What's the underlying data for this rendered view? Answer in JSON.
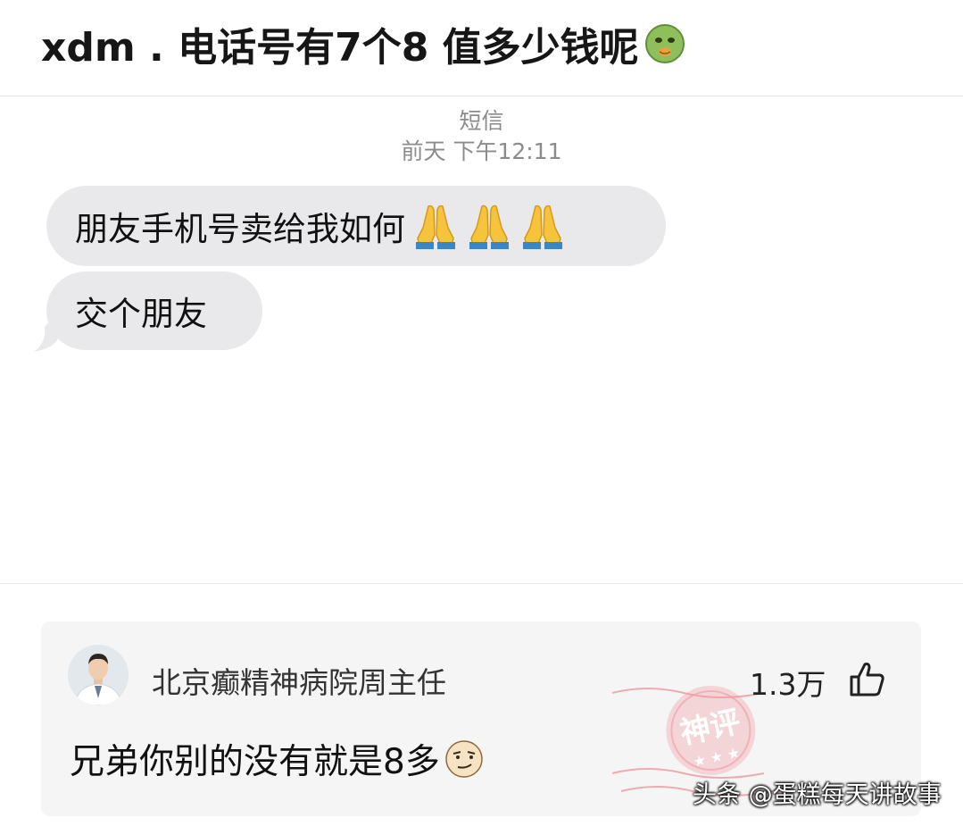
{
  "post": {
    "title": "xdm . 电话号有7个8 值多少钱呢",
    "title_emoji": "nauseated-face-emoji"
  },
  "sms": {
    "label": "短信",
    "timestamp": "前天 下午12:11",
    "messages": [
      {
        "text": "朋友手机号卖给我如何",
        "emoji": "folded-hands-emoji",
        "emoji_count": 3
      },
      {
        "text": "交个朋友"
      }
    ],
    "bubble_color": "#e9e9eb"
  },
  "comment": {
    "username": "北京癫精神病院周主任",
    "like_count": "1.3万",
    "like_icon": "thumbs-up-icon",
    "text": "兄弟你别的没有就是8多",
    "text_emoji": "smirk-face-emoji",
    "stamp_text": "神评",
    "stamp_color": "#e8707a",
    "card_background": "#f5f5f5"
  },
  "watermark": {
    "text": "头条 @蛋糕每天讲故事"
  }
}
